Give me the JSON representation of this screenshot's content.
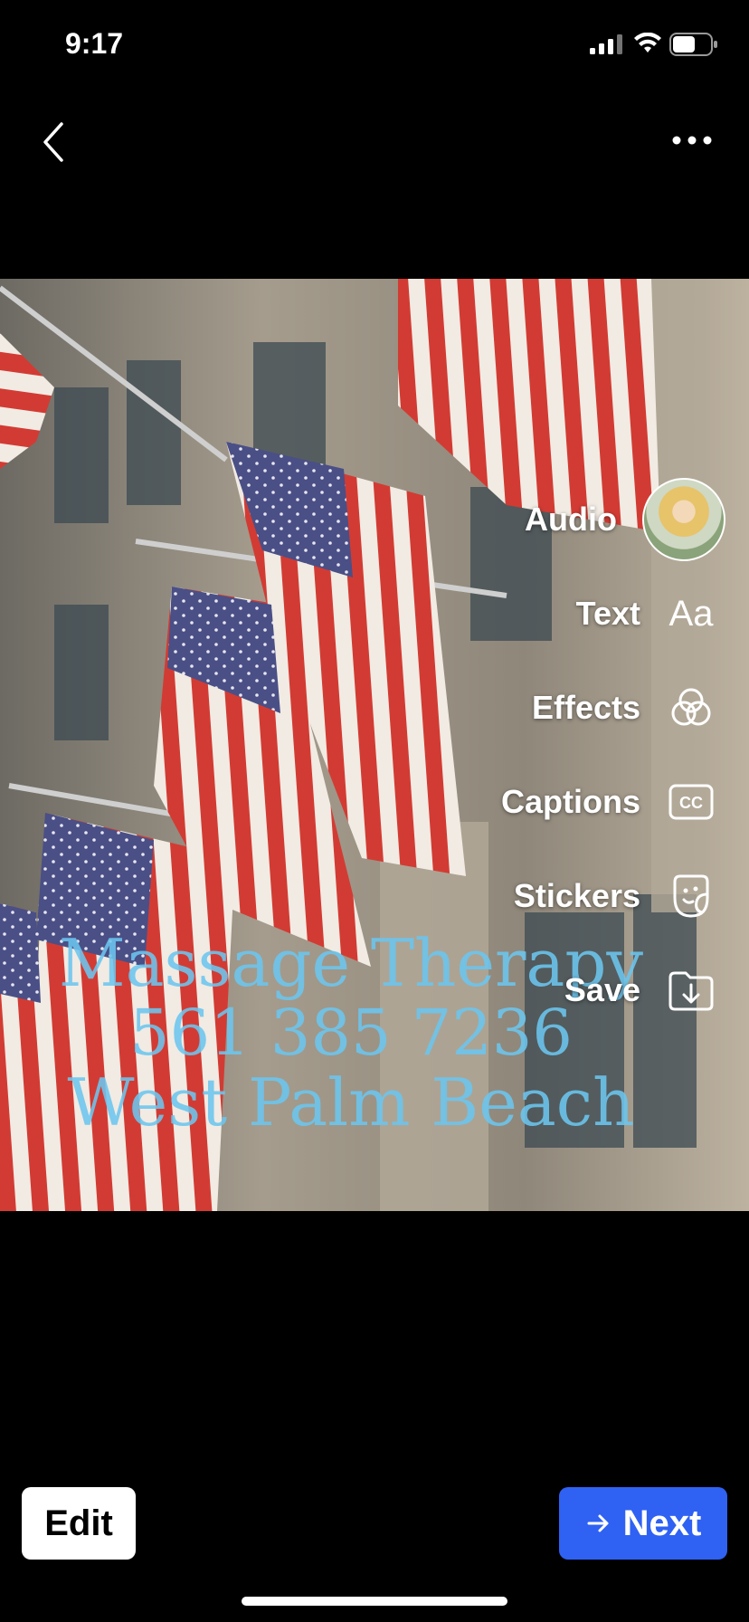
{
  "status": {
    "time": "9:17"
  },
  "overlay": {
    "line1": "Massage Therapy",
    "line2": "561 385 7236",
    "line3": "West Palm Beach"
  },
  "tools": [
    {
      "label": "Audio",
      "icon": "avatar"
    },
    {
      "label": "Text",
      "icon": "text-aa-icon",
      "glyph": "Aa"
    },
    {
      "label": "Effects",
      "icon": "effects-icon"
    },
    {
      "label": "Captions",
      "icon": "captions-icon"
    },
    {
      "label": "Stickers",
      "icon": "stickers-icon"
    },
    {
      "label": "Save",
      "icon": "save-icon"
    }
  ],
  "buttons": {
    "edit": "Edit",
    "next": "Next"
  },
  "colors": {
    "next_bg": "#2f62f3",
    "overlay_text": "#6cc6ef"
  }
}
